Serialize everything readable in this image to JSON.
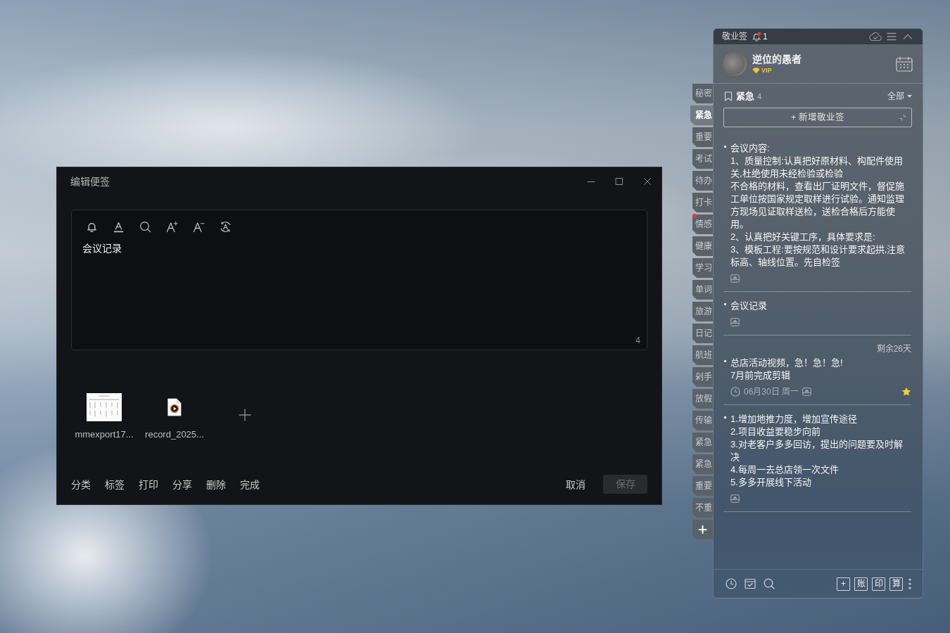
{
  "editor_window": {
    "title": "编辑便签",
    "content": "会议记录",
    "char_count": "4",
    "attachments": [
      {
        "kind": "image",
        "file_name": "mmexport17..."
      },
      {
        "kind": "video",
        "file_name": "record_2025..."
      }
    ],
    "actions": [
      "分类",
      "标签",
      "打印",
      "分享",
      "删除",
      "完成"
    ],
    "cancel_button": "取消",
    "save_button": {
      "label": "保存",
      "disabled": true
    }
  },
  "category_tabs": [
    {
      "label": "秘密",
      "selected": false,
      "unread": false
    },
    {
      "label": "紧急",
      "selected": true,
      "unread": false
    },
    {
      "label": "重要",
      "selected": false,
      "unread": false
    },
    {
      "label": "考试",
      "selected": false,
      "unread": false
    },
    {
      "label": "待办",
      "selected": false,
      "unread": false
    },
    {
      "label": "打卡",
      "selected": false,
      "unread": false
    },
    {
      "label": "情感",
      "selected": false,
      "unread": true
    },
    {
      "label": "健康",
      "selected": false,
      "unread": false
    },
    {
      "label": "学习",
      "selected": false,
      "unread": false
    },
    {
      "label": "单词",
      "selected": false,
      "unread": false
    },
    {
      "label": "旅游",
      "selected": false,
      "unread": false
    },
    {
      "label": "日记",
      "selected": false,
      "unread": false
    },
    {
      "label": "航班",
      "selected": false,
      "unread": false
    },
    {
      "label": "剁手",
      "selected": false,
      "unread": false
    },
    {
      "label": "放假",
      "selected": false,
      "unread": false
    },
    {
      "label": "传输",
      "selected": false,
      "unread": false
    },
    {
      "label": "紧急",
      "selected": false,
      "unread": false
    },
    {
      "label": "紧急",
      "selected": false,
      "unread": false
    },
    {
      "label": "重要",
      "selected": false,
      "unread": false
    },
    {
      "label": "不重",
      "selected": false,
      "unread": false
    }
  ],
  "notes_panel": {
    "title": "敬业签",
    "notification_count": "1",
    "user": {
      "name": "逆位的愚者",
      "level": "VIP"
    },
    "category": {
      "name": "紧急",
      "count": "4"
    },
    "filter": "全部",
    "new_note_button": "+ 新增敬业签",
    "notes": [
      {
        "paragraphs": [
          "会议内容:",
          "1、质量控制:认真把好原材料、构配件使用关,杜绝使用未经检验或检验",
          "不合格的材料，查看出厂证明文件，督促施工单位按国家规定取样进行试验。通知监理方现场见证取样送检，送检合格后方能使用。",
          "2、认真把好关键工序，具体要求是:",
          "3、模板工程:要按规范和设计要求起拱,注意标高、轴线位置。先自检签"
        ],
        "starred": false
      },
      {
        "paragraphs": [
          "会议记录"
        ],
        "starred": false
      },
      {
        "remaining": "剩余26天",
        "paragraphs": [
          "总店活动视频，急！急！急!",
          "7月前完成剪辑"
        ],
        "date": "06月30日 周一",
        "starred": true
      },
      {
        "paragraphs": [
          "1.增加地推力度，增加宣传途径",
          "2.项目收益要稳步向前",
          "3.对老客户多多回访，提出的问题要及时解决",
          "4.每周一去总店领一次文件",
          "5.多多开展线下活动"
        ],
        "starred": false
      }
    ],
    "toolbar_buttons": [
      "+",
      "账",
      "印",
      "算"
    ]
  }
}
